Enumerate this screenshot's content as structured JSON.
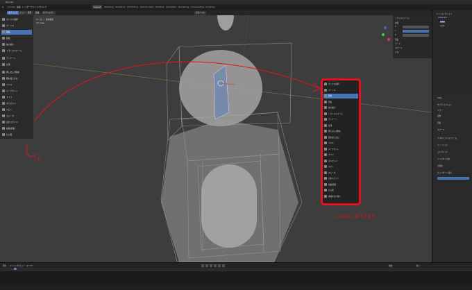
{
  "app": {
    "title": "Blender"
  },
  "menu": [
    "ファイル",
    "編集",
    "レンダー",
    "ウィンドウ",
    "ヘルプ"
  ],
  "workspace_tabs": [
    "Layout",
    "Modeling",
    "Sculpting",
    "UV Editing",
    "Texture Paint",
    "Shading",
    "Animation",
    "Rendering",
    "Compositing",
    "Scripting"
  ],
  "header": {
    "mode": "オブジェクト",
    "view": "ビュー",
    "select": "選択",
    "add": "追加",
    "object": "オブジェクト",
    "transform": "グローバル"
  },
  "viewport": {
    "overlay_line1": "ユーザー・透視投影",
    "overlay_line2": "(1) Cube"
  },
  "toolshelf": [
    "ボックス選択",
    "カーソル",
    "移動",
    "回転",
    "拡大縮小",
    "トランスフォーム",
    "アノテート",
    "計測",
    "押し出し(領域)",
    "面を差し込む",
    "ベベル",
    "ループカット",
    "ナイフ",
    "ポリビルド",
    "スピン",
    "スムーズ",
    "辺をスライド",
    "収縮/膨張",
    "せん断",
    "領域を切り裂く"
  ],
  "popup_items": [
    "ボックス選択",
    "カーソル",
    "移動",
    "回転",
    "拡大縮小",
    "トランスフォーム",
    "アノテート",
    "計測",
    "押し出し(領域)",
    "面を差し込む",
    "ベベル",
    "ループカット",
    "ナイフ",
    "ポリビルド",
    "スピン",
    "スムーズ",
    "辺をスライド",
    "収縮/膨張",
    "せん断",
    "領域を切り裂く"
  ],
  "npanel": {
    "title": "トランスフォーム",
    "rows": [
      "位置",
      "X",
      "Y",
      "Z",
      "回転",
      "モード",
      "スケール",
      "寸法"
    ]
  },
  "outliner": {
    "items": [
      "シーンコレクション",
      "Collection",
      "Cube",
      "Light"
    ]
  },
  "properties": {
    "rows": [
      "Cube",
      "サブディビジョン",
      "ミラー",
      "位置",
      "回転",
      "スケール",
      "デルタトランスフォーム",
      "リレーション",
      "コレクション",
      "インスタンス化",
      "可視性",
      "ビューポート表示"
    ]
  },
  "timeline": {
    "frame": "1",
    "start": "開始",
    "end": "終了",
    "menus": [
      "再生",
      "キーイング",
      "ビュー",
      "マーカー"
    ]
  },
  "annotations": {
    "left_note": "これ",
    "popup_note": "これがよく出てきます"
  },
  "colors": {
    "accent": "#4772b3",
    "annotation": "#e8101e"
  }
}
